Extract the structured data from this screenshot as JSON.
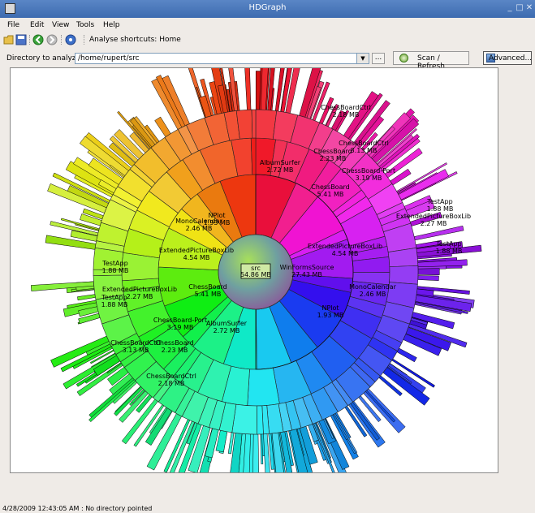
{
  "window": {
    "title": "HDGraph",
    "minimize": "_",
    "maximize": "□",
    "close": "✕"
  },
  "menu": [
    "File",
    "Edit",
    "View",
    "Tools",
    "Help"
  ],
  "toolbar": {
    "analyse_shortcuts": "Analyse shortcuts:",
    "home": "Home"
  },
  "directory": {
    "label": "Directory to analyze :",
    "value": "/home/rupert/src"
  },
  "buttons": {
    "browse": "...",
    "scan_refresh": "Scan / Refresh",
    "advanced": "Advanced..."
  },
  "status": {
    "text": "4/28/2009 12:43:05 AM : No directory pointed"
  },
  "chart": {
    "root": {
      "name": "src",
      "size": "54.86 MB"
    },
    "segments": [
      {
        "name": "WinFormsSource",
        "size": "27.43 MB"
      },
      {
        "name": "ExtendedPictureBoxLib",
        "size": "4.54 MB"
      },
      {
        "name": "ChessBoard",
        "size": "5.41 MB"
      },
      {
        "name": "AlbumSurfer",
        "size": "2.72 MB"
      },
      {
        "name": "ChessBoard",
        "size": "2.23 MB"
      },
      {
        "name": "ChessBoardCtrl",
        "size": "2.18 MB"
      },
      {
        "name": "ChessBoardCtrl",
        "size": "3.13 MB"
      },
      {
        "name": "ChessBoard-Port",
        "size": "3.19 MB"
      },
      {
        "name": "TestApp",
        "size": "1.88 MB"
      },
      {
        "name": "ExtendedPictureBoxLib",
        "size": "2.27 MB"
      },
      {
        "name": "TestApp",
        "size": "1.88 MB"
      },
      {
        "name": "MonoCalendar",
        "size": "2.46 MB"
      },
      {
        "name": "NPlot",
        "size": "1.93 MB"
      },
      {
        "name": "MonoCalendar",
        "size": "2.46 MB"
      },
      {
        "name": "NPlot",
        "size": "1.93 MB"
      },
      {
        "name": "ExtendedPictureBoxLib",
        "size": "4.54 MB"
      },
      {
        "name": "TestApp",
        "size": "1.88 MB"
      },
      {
        "name": "ExtendedPictureBoxLib",
        "size": "2.27 MB"
      },
      {
        "name": "TestApp",
        "size": "1.88 MB"
      },
      {
        "name": "ChessBoard",
        "size": "5.41 MB"
      },
      {
        "name": "AlbumSurfer",
        "size": "2.72 MB"
      },
      {
        "name": "ChessBoard-Port",
        "size": "3.19 MB"
      },
      {
        "name": "ChessBoardCtrl",
        "size": "3.13 MB"
      },
      {
        "name": "ChessBoard",
        "size": "2.23 MB"
      },
      {
        "name": "ChessBoardCtrl",
        "size": "2.18 MB"
      }
    ]
  }
}
